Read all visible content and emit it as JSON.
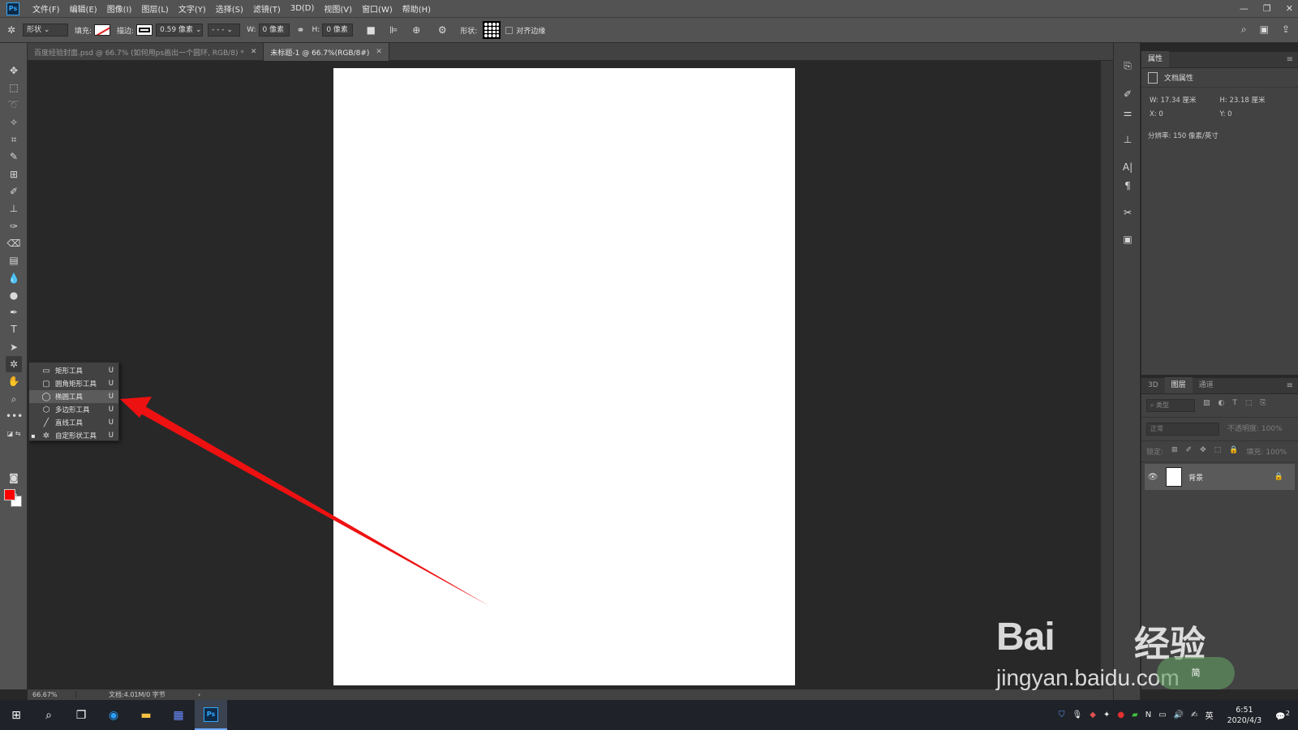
{
  "app": {
    "logo": "Ps"
  },
  "menu": [
    "文件(F)",
    "编辑(E)",
    "图像(I)",
    "图层(L)",
    "文字(Y)",
    "选择(S)",
    "滤镜(T)",
    "3D(D)",
    "视图(V)",
    "窗口(W)",
    "帮助(H)"
  ],
  "options": {
    "mode": "形状",
    "fill_label": "填充:",
    "stroke_label": "描边:",
    "stroke_width": "0.59 像素",
    "w_label": "W:",
    "w_value": "0 像素",
    "h_label": "H:",
    "h_value": "0 像素",
    "shape_label": "形状:",
    "align_edges": "对齐边缘"
  },
  "tabs": [
    {
      "label": "百度经验封面.psd @ 66.7% (如何用ps画出一个圆环, RGB/8) *",
      "active": false
    },
    {
      "label": "未标题-1 @ 66.7%(RGB/8#)",
      "active": true
    }
  ],
  "flyout": {
    "items": [
      {
        "label": "矩形工具",
        "key": "U",
        "icon": "rectangle-icon",
        "highlight": false,
        "current": false
      },
      {
        "label": "圆角矩形工具",
        "key": "U",
        "icon": "rounded-rectangle-icon",
        "highlight": false,
        "current": false
      },
      {
        "label": "椭圆工具",
        "key": "U",
        "icon": "ellipse-icon",
        "highlight": true,
        "current": false
      },
      {
        "label": "多边形工具",
        "key": "U",
        "icon": "polygon-icon",
        "highlight": false,
        "current": false
      },
      {
        "label": "直线工具",
        "key": "U",
        "icon": "line-icon",
        "highlight": false,
        "current": false
      },
      {
        "label": "自定形状工具",
        "key": "U",
        "icon": "custom-shape-icon",
        "highlight": false,
        "current": true
      }
    ]
  },
  "colors": {
    "foreground": "#ff0000",
    "background": "#ffffff",
    "arrow": "#ee1111"
  },
  "status": {
    "zoom": "66.67%",
    "doc_info": "文档:4.01M/0 字节"
  },
  "properties": {
    "tab": "属性",
    "title": "文档属性",
    "w": "W: 17.34 厘米",
    "h": "H: 23.18 厘米",
    "x": "X: 0",
    "y": "Y: 0",
    "resolution": "分辨率: 150 像素/英寸"
  },
  "layers": {
    "tabs": [
      "3D",
      "图层",
      "通道"
    ],
    "active_tab": "图层",
    "search_placeholder": "类型",
    "blend_mode": "正常",
    "opacity": "不透明度: 100%",
    "lock_label": "锁定:",
    "fill": "填充: 100%",
    "layer_name": "背景"
  },
  "watermark": {
    "brand": "Bai",
    "brand_cn": "经验",
    "url": "jingyan.baidu.com",
    "badge": "简"
  },
  "taskbar": {
    "time": "6:51",
    "date": "2020/4/3",
    "ime": "英",
    "notifications": "2"
  }
}
